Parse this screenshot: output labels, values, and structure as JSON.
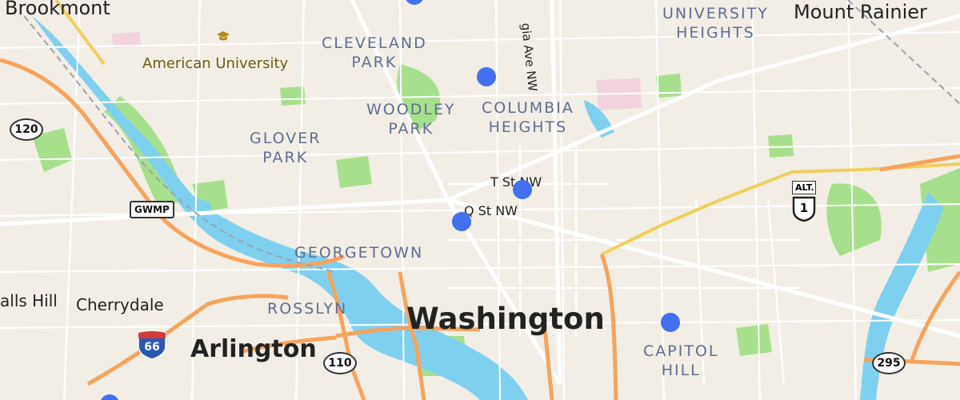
{
  "map": {
    "colors": {
      "land": "#f2eee6",
      "park": "#a7e08c",
      "water": "#7fd0ef",
      "highway": "#f7a35c",
      "trunk": "#f0cf5a",
      "road": "#ffffff",
      "marker": "#4270f0"
    },
    "neighborhoods": {
      "cleveland_park": "CLEVELAND\nPARK",
      "woodley_park": "WOODLEY\nPARK",
      "glover_park": "GLOVER\nPARK",
      "columbia_heights": "COLUMBIA\nHEIGHTS",
      "university_heights": "UNIVERSITY\nHEIGHTS",
      "georgetown": "GEORGETOWN",
      "rosslyn": "ROSSLYN",
      "capitol_hill": "CAPITOL\nHILL"
    },
    "places": {
      "brookmont": "Brookmont",
      "mount_rainier": "Mount Rainier",
      "washington": "Washington",
      "arlington": "Arlington",
      "cherrydale": "Cherrydale",
      "falls_hill": "alls Hill"
    },
    "pois": {
      "american_university": "American University"
    },
    "streets": {
      "georgia_ave": "gia Ave NW",
      "t_st": "T St NW",
      "q_st": "Q St NW"
    },
    "shields": {
      "r120": "120",
      "gwmp": "GWMP",
      "r110": "110",
      "r295": "295",
      "i66": "66",
      "alt": "ALT.",
      "us1": "1"
    },
    "markers": [
      "marker",
      "marker",
      "marker",
      "marker",
      "marker",
      "marker",
      "marker"
    ]
  }
}
